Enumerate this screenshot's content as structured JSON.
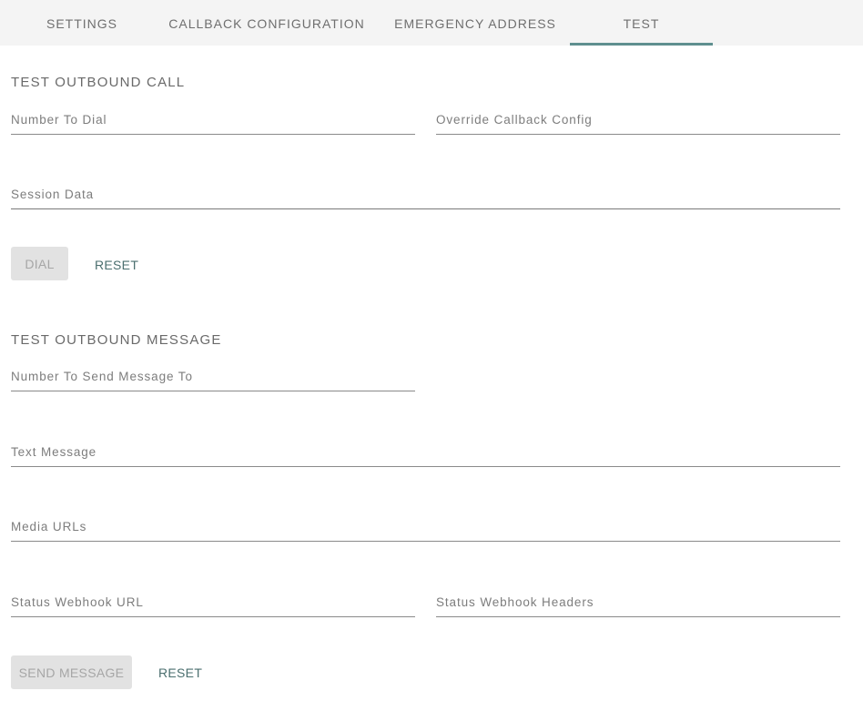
{
  "tabs": [
    {
      "label": "SETTINGS"
    },
    {
      "label": "CALLBACK CONFIGURATION"
    },
    {
      "label": "EMERGENCY ADDRESS"
    },
    {
      "label": "TEST"
    }
  ],
  "active_tab": "TEST",
  "accent_color": "#5f8f8f",
  "outbound_call": {
    "title": "TEST OUTBOUND CALL",
    "number_to_dial": {
      "label": "Number To Dial",
      "value": ""
    },
    "override_callback_config": {
      "label": "Override Callback Config",
      "value": ""
    },
    "session_data": {
      "label": "Session Data",
      "value": ""
    },
    "dial_button": "DIAL",
    "reset_button": "RESET"
  },
  "outbound_message": {
    "title": "TEST OUTBOUND MESSAGE",
    "number_to_send": {
      "label": "Number To Send Message To",
      "value": ""
    },
    "text_message": {
      "label": "Text Message",
      "value": ""
    },
    "media_urls": {
      "label": "Media URLs",
      "value": ""
    },
    "status_webhook_url": {
      "label": "Status Webhook URL",
      "value": ""
    },
    "status_webhook_headers": {
      "label": "Status Webhook Headers",
      "value": ""
    },
    "send_button": "SEND MESSAGE",
    "reset_button": "RESET"
  }
}
